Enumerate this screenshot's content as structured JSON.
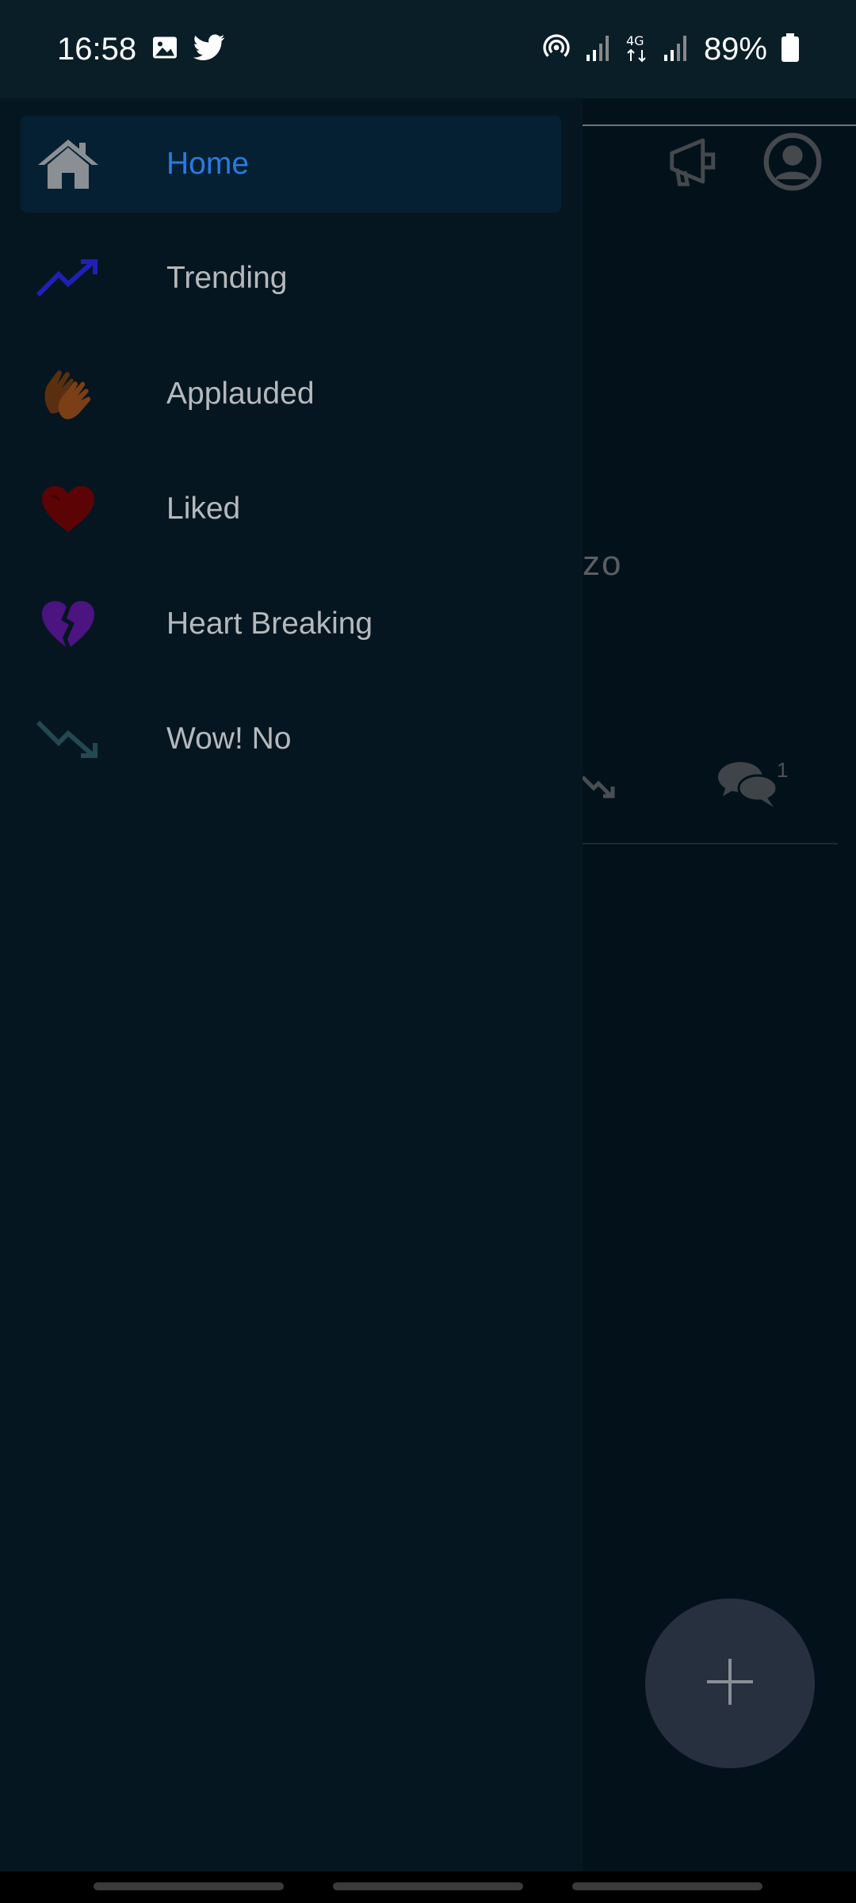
{
  "status_bar": {
    "time": "16:58",
    "battery": "89%",
    "icons": [
      "image-icon",
      "twitter-icon",
      "hotspot-icon",
      "signal-icon",
      "4g-icon",
      "signal-icon",
      "battery-icon"
    ]
  },
  "drawer": {
    "items": [
      {
        "label": "Home",
        "icon": "home-icon",
        "active": true
      },
      {
        "label": "Trending",
        "icon": "trending-up-icon"
      },
      {
        "label": "Applauded",
        "icon": "clapping-hands-icon"
      },
      {
        "label": "Liked",
        "icon": "heart-icon"
      },
      {
        "label": "Heart Breaking",
        "icon": "broken-heart-icon"
      },
      {
        "label": "Wow! No",
        "icon": "trending-down-icon"
      }
    ]
  },
  "background": {
    "partial_text": "zo",
    "comment_count": "1",
    "icons": [
      "megaphone-icon",
      "account-icon",
      "trending-down-icon",
      "comments-icon",
      "plus-icon"
    ]
  },
  "colors": {
    "accent": "#2a7be0",
    "drawer_bg": "#061620",
    "active_bg": "#052033",
    "status_bar_bg": "#0a1e28"
  }
}
